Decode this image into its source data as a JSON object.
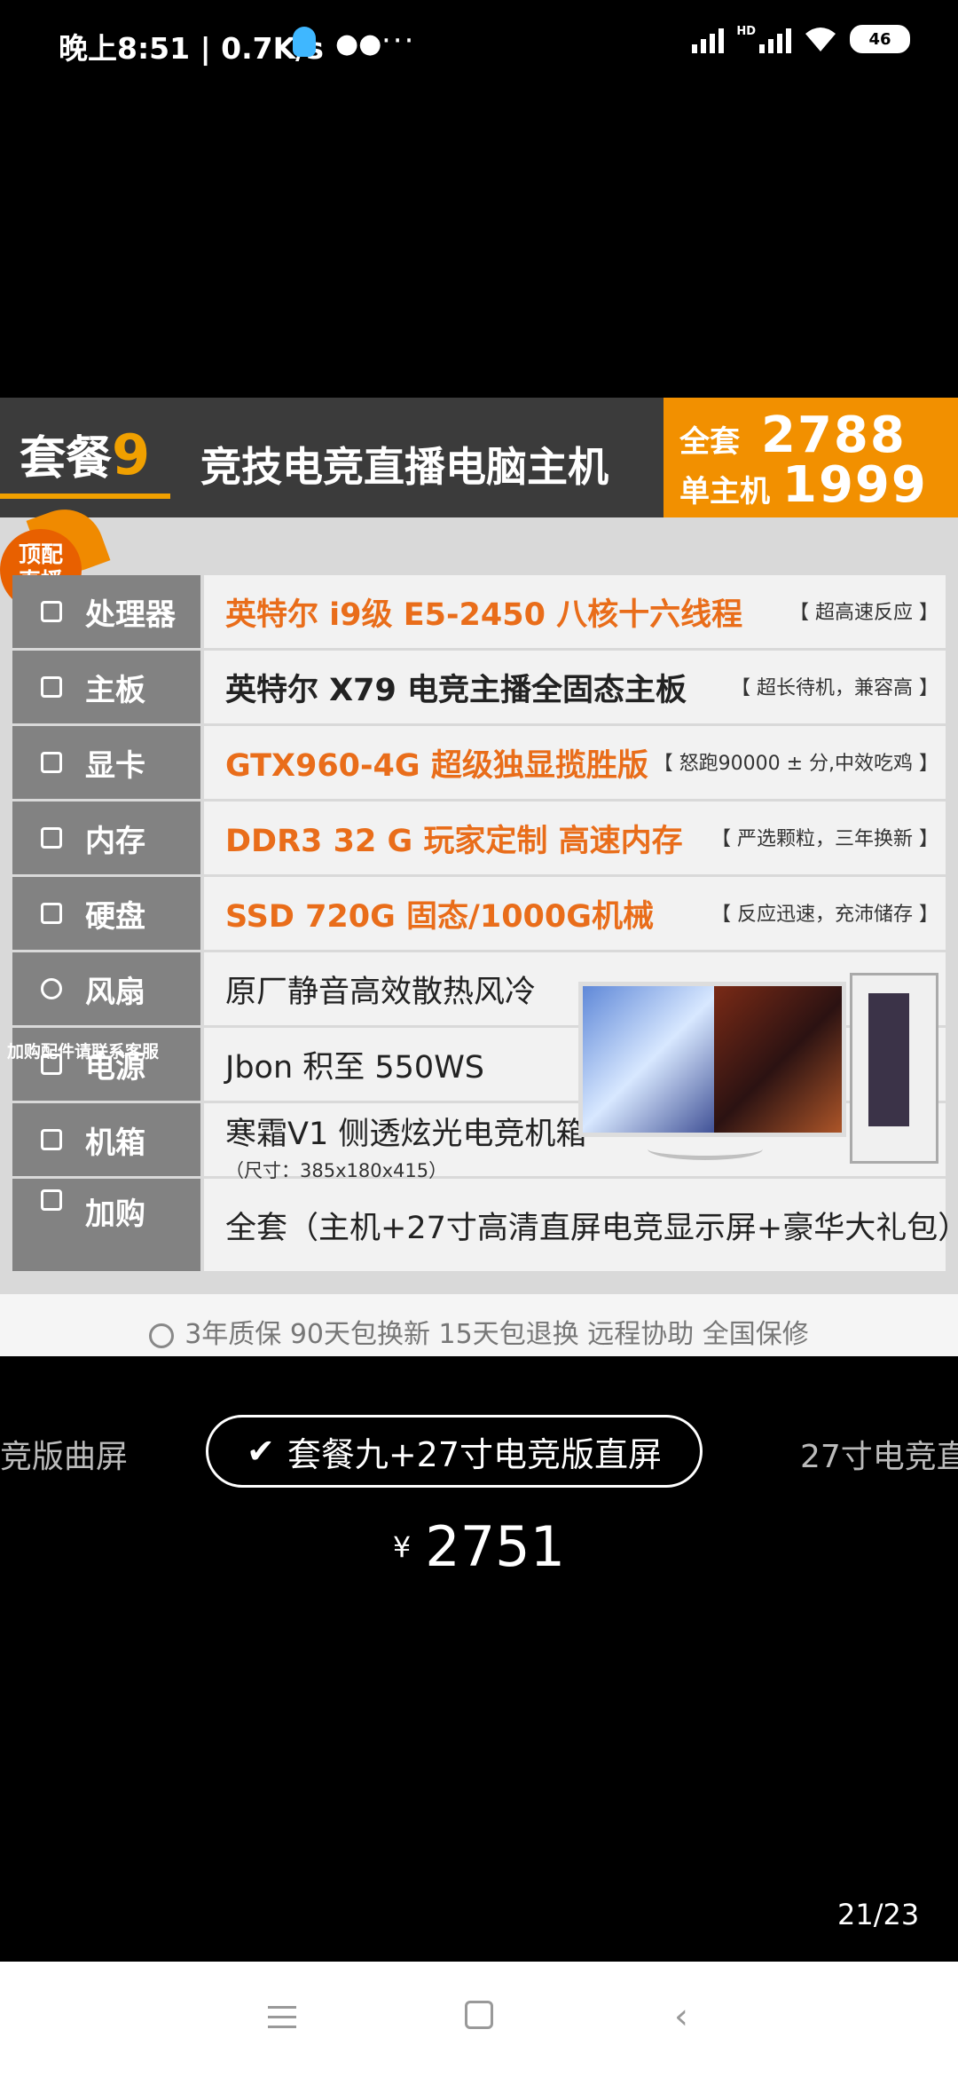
{
  "status_bar": {
    "time_speed": "晚上8:51 | 0.7K/s",
    "battery": "46",
    "hd": "HD",
    "dots": "···"
  },
  "promo": {
    "package_label": "套餐",
    "package_number": "9",
    "title": "竞技电竞直播电脑主机",
    "price_box": {
      "full_label": "全套",
      "full_value": "2788",
      "host_label": "单主机",
      "host_value": "1999"
    },
    "badge": [
      "顶配",
      "直播"
    ],
    "specs": [
      {
        "label": "处理器",
        "value": "英特尔 i9级 E5-2450 八核十六线程",
        "note": "【 超高速反应 】",
        "color": "orange"
      },
      {
        "label": "主板",
        "value": "英特尔 X79 电竞主播全固态主板",
        "note": "【 超长待机，兼容高 】",
        "color": "dark"
      },
      {
        "label": "显卡",
        "value": "GTX960-4G 超级独显揽胜版",
        "note": "【 怒跑90000 ± 分,中效吃鸡 】",
        "color": "orange"
      },
      {
        "label": "内存",
        "value": "DDR3 32 G 玩家定制 高速内存",
        "note": "【 严选颗粒，三年换新 】",
        "color": "orange"
      },
      {
        "label": "硬盘",
        "value": "SSD 720G 固态/1000G机械",
        "note": "【 反应迅速，充沛储存 】",
        "color": "orange"
      },
      {
        "label": "风扇",
        "value": "原厂静音高效散热风冷",
        "note": "",
        "color": "dark"
      },
      {
        "label": "电源",
        "value": "Jbon 积至 550WS",
        "note": "",
        "color": "dark"
      },
      {
        "label": "机箱",
        "value": "寒霜V1 侧透炫光电竞机箱",
        "note": "",
        "color": "dark",
        "sub": "（尺寸：385x180x415）"
      },
      {
        "label": "加购",
        "value": "全套（主机+27寸高清直屏电竞显示屏+豪华大礼包）",
        "note": "",
        "color": "dark"
      }
    ],
    "addon_note": "加购配件请联系客服",
    "footer": "3年质保 90天包换新 15天包退换 远程协助 全国保修"
  },
  "options": {
    "left_partial": "竞版曲屏",
    "selected": "套餐九+27寸电竞版直屏",
    "right_partial": "27寸电竞直"
  },
  "price": {
    "currency": "¥",
    "amount": "2751"
  },
  "page_indicator": "21/23"
}
